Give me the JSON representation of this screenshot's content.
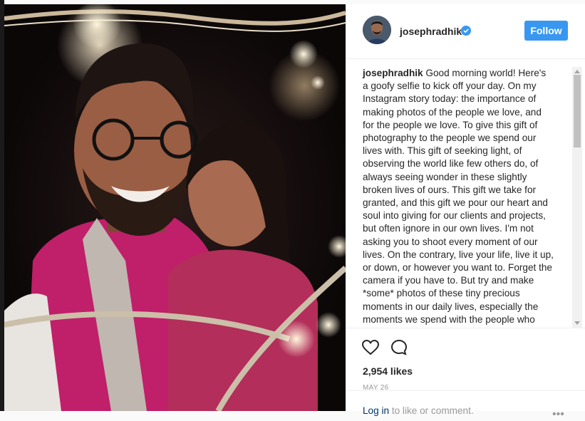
{
  "post": {
    "username": "josephradhik",
    "verified_badge": "verified-badge-icon",
    "follow_label": "Follow",
    "caption_username": "josephradhik",
    "caption_text": "Good morning world! Here's a goofy selfie to kick off your day. On my Instagram story today: the importance of making photos of the people we love, and for the people we love. To give this gift of photography to the people we spend our lives with. This gift of seeking light, of observing the world like few others do, of always seeing wonder in these slightly broken lives of ours. This gift we take for granted, and this gift we pour our heart and soul into giving for our clients and projects, but often ignore in our own lives. I'm not asking you to shoot every moment of our lives. On the contrary, live your life, live it up, or down, or however you want to. Forget the camera if you have to. But try and make *some* photos of these tiny precious moments in our daily lives, especially the moments we spend with the people who make this life worth living.",
    "likes": "2,954 likes",
    "date": "MAY 26",
    "login_link": "Log in",
    "login_suffix": " to like or comment.",
    "more_icon": "more-options-icon"
  },
  "colors": {
    "follow_button": "#3897f0",
    "verified_badge": "#3897f0",
    "text": "#262626",
    "muted": "#999999"
  }
}
